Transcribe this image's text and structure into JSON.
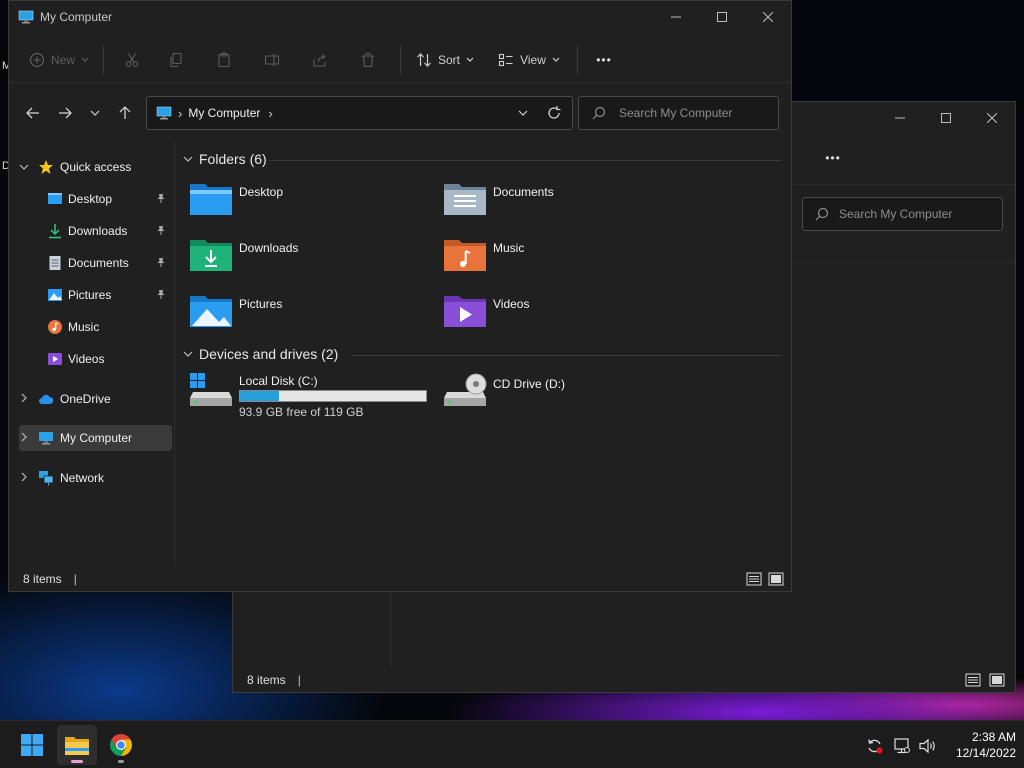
{
  "desktop": {
    "partial_letter_1": "M",
    "partial_letter_2": "D"
  },
  "back_window": {
    "search_placeholder": "Search My Computer",
    "status_items": "8 items"
  },
  "window": {
    "title": "My Computer",
    "toolbar": {
      "new_label": "New",
      "sort_label": "Sort",
      "view_label": "View",
      "more_label": "•••"
    },
    "address": {
      "path": "My Computer",
      "separator": "›"
    },
    "search_placeholder": "Search My Computer",
    "nav": {
      "quick_access": "Quick access",
      "quick_items": [
        {
          "label": "Desktop",
          "pinned": true
        },
        {
          "label": "Downloads",
          "pinned": true
        },
        {
          "label": "Documents",
          "pinned": true
        },
        {
          "label": "Pictures",
          "pinned": true
        },
        {
          "label": "Music",
          "pinned": false
        },
        {
          "label": "Videos",
          "pinned": false
        }
      ],
      "onedrive": "OneDrive",
      "my_computer": "My Computer",
      "network": "Network"
    },
    "folders_group": "Folders (6)",
    "folders": [
      "Desktop",
      "Documents",
      "Downloads",
      "Music",
      "Pictures",
      "Videos"
    ],
    "drives_group": "Devices and drives (2)",
    "drives": [
      {
        "label": "Local Disk (C:)",
        "free_text": "93.9 GB free of 119 GB",
        "used_fraction": 0.211
      },
      {
        "label": "CD Drive (D:)"
      }
    ],
    "status_items": "8 items"
  },
  "taskbar": {
    "time": "2:38 AM",
    "date": "12/14/2022"
  },
  "colors": {
    "accent": "#1f8fe0",
    "folder_blue": "#2a9df0",
    "folder_green": "#1fb37a",
    "folder_orange": "#e8743b",
    "folder_purple": "#8a4fd8"
  }
}
